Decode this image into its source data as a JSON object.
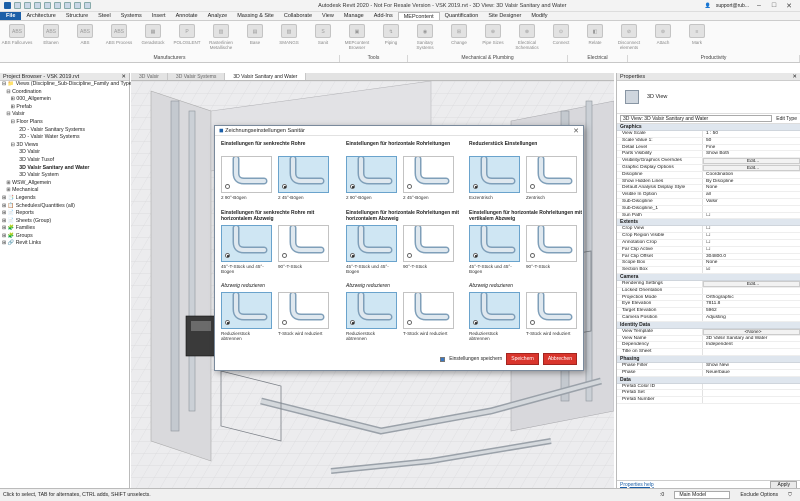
{
  "titlebar": {
    "title": "Autodesk Revit 2020 - Not For Resale Version - VSK 2019.rvt - 3D View: 3D Valsir Sanitary and Water",
    "user": "support@rub...",
    "min": "–",
    "max": "□",
    "close": "✕"
  },
  "tabs": [
    "File",
    "Architecture",
    "Structure",
    "Steel",
    "Systems",
    "Insert",
    "Annotate",
    "Analyze",
    "Massing & Site",
    "Collaborate",
    "View",
    "Manage",
    "Add-Ins",
    "MEPcontent",
    "Quantification",
    "Site Designer",
    "Modify"
  ],
  "active_tab": "MEPcontent",
  "ribbon": {
    "buttons": [
      {
        "icon": "ABS",
        "label": "ABS Fallcurves"
      },
      {
        "icon": "ABS",
        "label": "Eltanen"
      },
      {
        "icon": "ABS",
        "label": "ABS"
      },
      {
        "icon": "ABS",
        "label": "ABS Process"
      },
      {
        "icon": "▦",
        "label": "Geradstück"
      },
      {
        "icon": "P",
        "label": "POLOSLENT"
      },
      {
        "icon": "▥",
        "label": "Rasterlinien Metallische"
      },
      {
        "icon": "▤",
        "label": "Base"
      },
      {
        "icon": "▧",
        "label": "SMANGS"
      },
      {
        "icon": "S",
        "label": "Sanit"
      },
      {
        "icon": "▣",
        "label": "MEPcontent Browser"
      },
      {
        "icon": "↯",
        "label": "Piping"
      },
      {
        "icon": "◉",
        "label": "Sanitary Systems"
      },
      {
        "icon": "⊞",
        "label": "Change"
      },
      {
        "icon": "⊕",
        "label": "Pipe Sizes"
      },
      {
        "icon": "⊗",
        "label": "Electrical Schematics"
      },
      {
        "icon": "⊙",
        "label": "Connect"
      },
      {
        "icon": "◧",
        "label": "Relate"
      },
      {
        "icon": "⊘",
        "label": "Disconnect elements"
      },
      {
        "icon": "⊚",
        "label": "Attach"
      },
      {
        "icon": "≡",
        "label": "Mark"
      }
    ],
    "groups": [
      {
        "label": "Manufacturers"
      },
      {
        "label": "Tools"
      },
      {
        "label": "Mechanical & Plumbing"
      },
      {
        "label": "Electrical"
      },
      {
        "label": "Productivity"
      }
    ]
  },
  "project_browser": {
    "title": "Project Browser - VSK 2019.rvt",
    "close": "✕",
    "items": [
      "⊟ 📁 Views (Discipline_Sub-Discipline_Family and Type)",
      "   ⊟ Coordination",
      "      ⊞ 000_Allgemein",
      "      ⊞ Prefab",
      "   ⊟ Valsir",
      "      ⊟ Floor Plans",
      "            2D - Valsir Sanitary Systems",
      "            2D - Valsir Water Systems",
      "      ⊟ 3D Views",
      "            3D Valsir",
      "            3D Valsir Tusof",
      "            3D Valsir Sanitary and Water",
      "            3D Valsir System",
      "   ⊞ WSW_Allgemein",
      "   ⊞ Mechanical",
      "⊞ 📑 Legends",
      "⊞ 📋 Schedules/Quantities (all)",
      "⊞ 📄 Reports",
      "⊞ 📄 Sheets (Group)",
      "⊞ 🧩 Families",
      "⊞ 🧩 Groups",
      "⊞ 🔗 Revit Links"
    ],
    "bold_index": 11
  },
  "view_tabs": [
    "3D Valsir",
    "3D Valsir Systems",
    "3D Valsir Sanitary and Water"
  ],
  "active_view_tab": 2,
  "properties": {
    "title": "Properties",
    "type_name": "3D View",
    "view_selector": "3D View: 3D Valsir Sanitary and Water",
    "edit_type": "Edit Type",
    "sections": [
      {
        "name": "Graphics",
        "rows": [
          [
            "View Scale",
            "1 : 50"
          ],
          [
            "Scale Value  1:",
            "50"
          ],
          [
            "Detail Level",
            "Fine"
          ],
          [
            "Parts Visibility",
            "Show Both"
          ],
          [
            "Visibility/Graphics Overrides",
            "Edit..."
          ],
          [
            "Graphic Display Options",
            "Edit..."
          ],
          [
            "Discipline",
            "Coordination"
          ],
          [
            "Show Hidden Lines",
            "By Discipline"
          ],
          [
            "Default Analysis Display Style",
            "None"
          ],
          [
            "Visible In Option",
            "all"
          ],
          [
            "Sub-Discipline",
            "Valsir"
          ],
          [
            "Sub-Discipline_1",
            ""
          ],
          [
            "Sun Path",
            "☐"
          ]
        ]
      },
      {
        "name": "Extents",
        "rows": [
          [
            "Crop View",
            "☐"
          ],
          [
            "Crop Region Visible",
            "☐"
          ],
          [
            "Annotation Crop",
            "☐"
          ],
          [
            "Far Clip Active",
            "☐"
          ],
          [
            "Far Clip Offset",
            "304800.0"
          ],
          [
            "Scope Box",
            "None"
          ],
          [
            "Section Box",
            "☑"
          ]
        ]
      },
      {
        "name": "Camera",
        "rows": [
          [
            "Rendering Settings",
            "Edit..."
          ],
          [
            "Locked Orientation",
            ""
          ],
          [
            "Projection Mode",
            "Orthographic"
          ],
          [
            "Eye Elevation",
            "7811.8"
          ],
          [
            "Target Elevation",
            "5962"
          ],
          [
            "Camera Position",
            "Adjusting"
          ]
        ]
      },
      {
        "name": "Identity Data",
        "rows": [
          [
            "View Template",
            "<None>"
          ],
          [
            "View Name",
            "3D Valsir Sanitary and Water"
          ],
          [
            "Dependency",
            "Independent"
          ],
          [
            "Title on Sheet",
            ""
          ]
        ]
      },
      {
        "name": "Phasing",
        "rows": [
          [
            "Phase Filter",
            "Show New"
          ],
          [
            "Phase",
            "Neuerbaue"
          ]
        ]
      },
      {
        "name": "Data",
        "rows": [
          [
            "Prefab Color ID",
            ""
          ],
          [
            "Prefab Set",
            ""
          ],
          [
            "Prefab Number",
            ""
          ]
        ]
      }
    ],
    "help_link": "Properties help",
    "apply": "Apply"
  },
  "statusbar": {
    "message": "Click to select, TAB for alternates, CTRL adds, SHIFT unselects.",
    "zero": ":0",
    "model": "Main Model",
    "exclude": "Exclude Options"
  },
  "dialog": {
    "title": "Zeichnungseinstellungen Sanitär",
    "close": "✕",
    "sections": [
      {
        "heading": "Einstellungen für senkrechte Rohre",
        "options": [
          {
            "label": "2 90°-Bögen",
            "selected": false
          },
          {
            "label": "2 45°-Bögen",
            "selected": true
          }
        ]
      },
      {
        "heading": "Einstellungen für horizontale Rohrleitungen",
        "options": [
          {
            "label": "2 90°-Bögen",
            "selected": true
          },
          {
            "label": "2 45°-Bögen",
            "selected": false
          }
        ]
      },
      {
        "heading": "Reduzierstück Einstellungen",
        "options": [
          {
            "label": "Exzentrisch",
            "selected": true
          },
          {
            "label": "Zentrisch",
            "selected": false
          }
        ]
      },
      {
        "heading": "Einstellungen für senkrechte Rohre mit horizontalem Abzweig",
        "options": [
          {
            "label": "45°-T-Stück und 45°-Bogen",
            "selected": true
          },
          {
            "label": "90°-T-Stück",
            "selected": false
          }
        ]
      },
      {
        "heading": "Einstellungen für horizontale Rohrleitungen mit horizontalem Abzweig",
        "options": [
          {
            "label": "45°-T-Stück und 45°-Bogen",
            "selected": true
          },
          {
            "label": "90°-T-Stück",
            "selected": false
          }
        ]
      },
      {
        "heading": "Einstellungen für horizontale Rohrleitungen mit vertikalem Abzweig",
        "options": [
          {
            "label": "45°-T-Stück und 45°-Bogen",
            "selected": true
          },
          {
            "label": "90°-T-Stück",
            "selected": false
          }
        ]
      },
      {
        "heading": "Abzweig reduzieren",
        "options": [
          {
            "label": "Reduzierstück abtrennen",
            "selected": true
          },
          {
            "label": "T-Stück wird reduziert",
            "selected": false
          }
        ]
      },
      {
        "heading": "Abzweig reduzieren",
        "options": [
          {
            "label": "Reduzierstück abtrennen",
            "selected": true
          },
          {
            "label": "T-Stück wird reduziert",
            "selected": false
          }
        ]
      },
      {
        "heading": "Abzweig reduzieren",
        "options": [
          {
            "label": "Reduzierstück abtrennen",
            "selected": true
          },
          {
            "label": "T-Stück wird reduziert",
            "selected": false
          }
        ]
      }
    ],
    "save_settings_label": "Einstellungen speichern",
    "save_button": "Speichern",
    "cancel_button": "Abbrechen"
  },
  "colors": {
    "accent": "#1b5fa8",
    "dialog_button": "#d9352c",
    "selected_thumb": "#cfe6f3"
  }
}
